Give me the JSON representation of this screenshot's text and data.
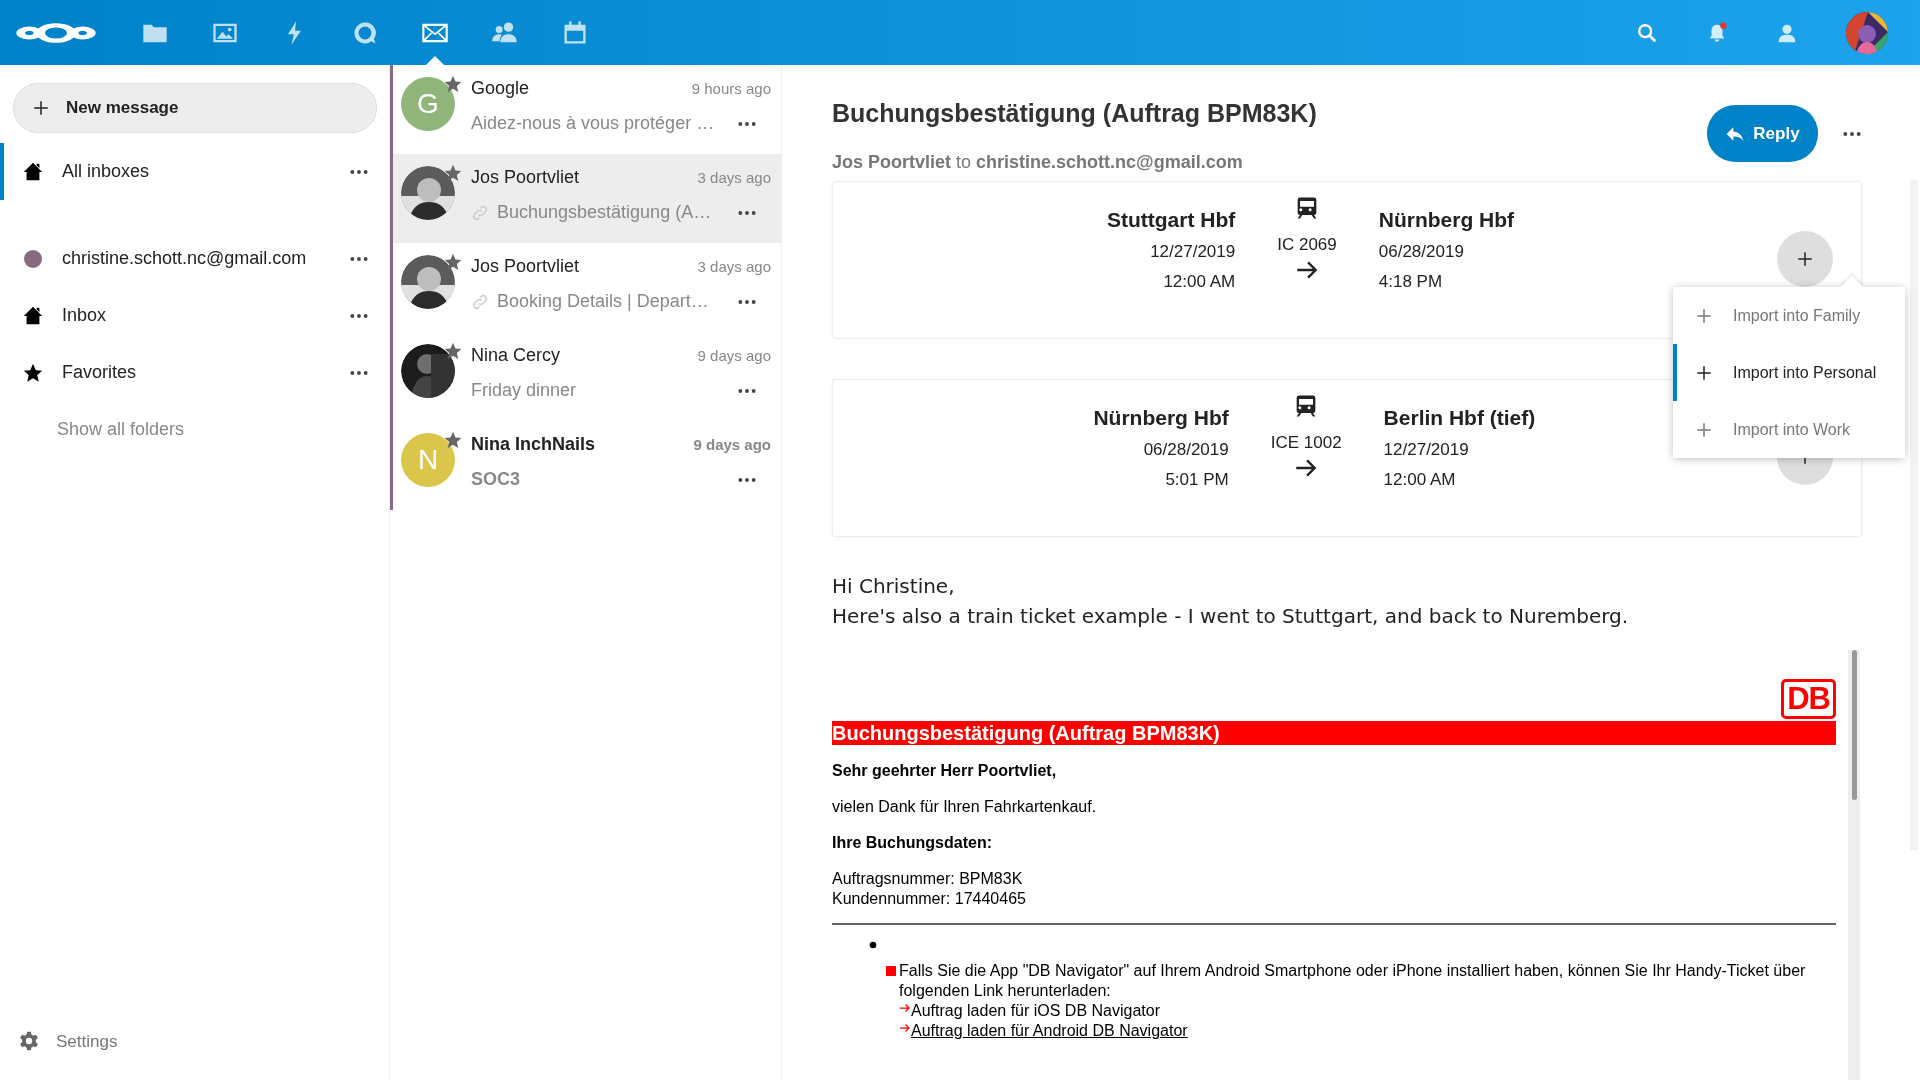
{
  "topbar": {
    "apps": [
      {
        "kind": "files",
        "selected": false
      },
      {
        "kind": "photos",
        "selected": false
      },
      {
        "kind": "activity",
        "selected": false
      },
      {
        "kind": "talk",
        "selected": false
      },
      {
        "kind": "mail",
        "selected": true
      },
      {
        "kind": "contacts",
        "selected": false
      },
      {
        "kind": "calendar",
        "selected": false
      }
    ],
    "notifications_unread": true
  },
  "sidebar": {
    "new_message": "New message",
    "items": [
      {
        "kind": "home",
        "label": "All inboxes",
        "selected": true
      },
      {
        "kind": "account",
        "label": "christine.schott.nc@gmail.com",
        "color": "#876a80",
        "selected": false
      },
      {
        "kind": "home",
        "label": "Inbox",
        "selected": false
      },
      {
        "kind": "star",
        "label": "Favorites",
        "selected": false
      }
    ],
    "show_all": "Show all folders",
    "settings": "Settings"
  },
  "messages": [
    {
      "sender": "Google",
      "time": "9 hours ago",
      "subject": "Aidez-nous à vous protéger …",
      "avatar": {
        "kind": "letter",
        "letter": "G",
        "color": "#8fb57a"
      },
      "attachment": false,
      "unread": false,
      "selected": false
    },
    {
      "sender": "Jos Poortvliet",
      "time": "3 days ago",
      "subject": "Buchungsbestätigung (A…",
      "attachment": true,
      "unread": false,
      "selected": true
    },
    {
      "sender": "Jos Poortvliet",
      "time": "3 days ago",
      "subject": "Booking Details | Depart…",
      "attachment": true,
      "unread": false,
      "selected": false
    },
    {
      "sender": "Nina Cercy",
      "time": "9 days ago",
      "subject": "Friday dinner",
      "attachment": false,
      "unread": false,
      "selected": false
    },
    {
      "sender": "Nina InchNails",
      "time": "9 days ago",
      "subject": "SOC3",
      "avatar": {
        "kind": "letter",
        "letter": "N",
        "color": "#d9c64a"
      },
      "attachment": false,
      "unread": true,
      "selected": false
    }
  ],
  "message": {
    "subject": "Buchungsbestätigung (Auftrag BPM83K)",
    "from": "Jos Poortvliet",
    "to_word": "to",
    "to": "christine.schott.nc@gmail.com",
    "reply": "Reply",
    "trips": [
      {
        "from_station": "Stuttgart Hbf",
        "from_date": "12/27/2019",
        "from_time": "12:00 AM",
        "train": "IC 2069",
        "to_station": "Nürnberg Hbf",
        "to_date": "06/28/2019",
        "to_time": "4:18 PM"
      },
      {
        "from_station": "Nürnberg Hbf",
        "from_date": "06/28/2019",
        "from_time": "5:01 PM",
        "train": "ICE 1002",
        "to_station": "Berlin Hbf (tief)",
        "to_date": "12/27/2019",
        "to_time": "12:00 AM"
      }
    ],
    "import_menu": [
      {
        "label": "Import into Family",
        "selected": false
      },
      {
        "label": "Import into Personal",
        "selected": true
      },
      {
        "label": "Import into Work",
        "selected": false
      }
    ],
    "body": {
      "greeting": "Hi Christine,",
      "intro": "Here's also a train ticket example - I went to Stuttgart, and back to Nuremberg.",
      "logo": "DB",
      "heading": "Buchungsbestätigung (Auftrag BPM83K)",
      "salutation": "Sehr geehrter Herr Poortvliet,",
      "thanks": "vielen Dank für Ihren Fahrkartenkauf.",
      "data_heading": "Ihre Buchungsdaten:",
      "order_number": "Auftragsnummer: BPM83K",
      "customer_number": "Kundennummer: 17440465",
      "app_note": "Falls Sie die App \"DB Navigator\" auf Ihrem Android Smartphone oder iPhone installiert haben, können Sie Ihr Handy-Ticket über folgenden Link herunterladen:",
      "links": [
        {
          "label": "Auftrag laden für iOS DB Navigator",
          "underlined": false
        },
        {
          "label": "Auftrag laden für Android DB Navigator",
          "underlined": true
        }
      ]
    }
  }
}
